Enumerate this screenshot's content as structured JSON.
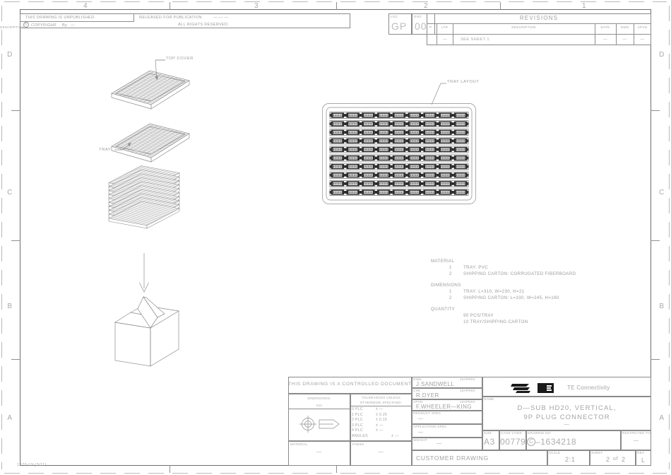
{
  "document": {
    "footer_code": "1470-19  (3/11)",
    "zone_numbers": [
      "4",
      "3",
      "2",
      "1"
    ],
    "zone_letters": [
      "D",
      "C",
      "B",
      "A"
    ]
  },
  "header": {
    "unpublished": "THIS DRAWING IS UNPUBLISHED.",
    "copyright_symbol": "C",
    "copyright_label": "COPYRIGHT",
    "copyright_value": "—",
    "by_label": "By",
    "by_value": "—",
    "released": "RELEASED FOR PUBLICATION",
    "released_value": "—.—  —",
    "all_rights": "ALL RIGHTS RESERVED."
  },
  "locdist": {
    "loc_label": "LOC",
    "loc_value": "GP",
    "dist_label": "DIST",
    "dist_value": "00"
  },
  "revisions": {
    "title": "REVISIONS",
    "columns": [
      "P",
      "LTR",
      "DESCRIPTION",
      "DATE",
      "DWN",
      "APVD"
    ],
    "rows": [
      {
        "p": "",
        "ltr": "—",
        "description": "SEE SHEET 1",
        "date": "—",
        "dwn": "—",
        "apvd": "—"
      }
    ]
  },
  "views": {
    "top_cover_label": "TOP COVER",
    "tray_label": "TRAY",
    "tray_layout_label": "TRAY LAYOUT",
    "tray_layout": {
      "rows": 10,
      "columns": 9
    },
    "stack_count": 10
  },
  "notes": {
    "material": {
      "heading": "MATERIAL",
      "items": [
        {
          "num": "1",
          "text": "TRAY: PVC"
        },
        {
          "num": "2",
          "text": "SHIPPING CARTON: CORRUGATED FIBERBOARD"
        }
      ]
    },
    "dimensions": {
      "heading": "DIMENSIONS",
      "items": [
        {
          "num": "1",
          "text": "TRAY: L=310, W=230, H=21"
        },
        {
          "num": "2",
          "text": "SHIPPING CARTON: L=330, W=245, H=160"
        }
      ]
    },
    "quantity": {
      "heading": "QUANTITY",
      "items": [
        {
          "num": "",
          "text": "90 PCS/TRAY"
        },
        {
          "num": "",
          "text": "10 TRAY/SHIPPING CARTON"
        }
      ]
    }
  },
  "titleblock": {
    "controlled": "THIS DRAWING IS A CONTROLLED DOCUMENT.",
    "dimensions_label": "DIMENSIONS:",
    "dimensions_units": "mm",
    "tolerances_label_1": "TOLERANCES UNLESS",
    "tolerances_label_2": "OTHERWISE SPECIFIED:",
    "tolerances": [
      {
        "name": "0 PLC",
        "value": "± —"
      },
      {
        "name": "1 PLC",
        "value": "± 0.25"
      },
      {
        "name": "2 PLC",
        "value": "± 0.15"
      },
      {
        "name": "3 PLC",
        "value": "± —"
      },
      {
        "name": "4 PLC",
        "value": "± —"
      },
      {
        "name": "ANGLES",
        "value": "± —"
      }
    ],
    "material_label": "MATERIAL",
    "material_value": "—",
    "finish_label": "FINISH",
    "finish_value": "—",
    "dwn_label": "DWN",
    "dwn_value": "J.SANDWELL",
    "dwn_date": "10APR03",
    "chk_label": "CHK",
    "chk_value": "R.DYER",
    "chk_date": "10APR03",
    "apvd_label": "APVD",
    "apvd_value": "F.WHEELER—KING",
    "apvd_date": "10APR03",
    "product_spec_label": "PRODUCT SPEC",
    "product_spec_value": "—",
    "application_spec_label": "APPLICATION SPEC",
    "application_spec_value": "—",
    "weight_label": "WEIGHT",
    "weight_value": "—",
    "customer_drawing": "CUSTOMER DRAWING",
    "company_logo": "TE",
    "company_name": "TE Connectivity",
    "name_label": "NAME",
    "name_line1": "D—SUB HD20, VERTICAL,",
    "name_line2": "9P PLUG CONNECTOR",
    "name_line3": "—",
    "size_label": "SIZE",
    "size_value": "A3",
    "cage_label": "CAGE CODE",
    "cage_value": "00779",
    "drawing_no_label": "DRAWING NO",
    "drawing_no_prefix": "C",
    "drawing_no_value": "–1634218",
    "restricted_label": "RESTRICTED TO",
    "restricted_value": "—",
    "scale_label": "SCALE",
    "scale_value": "2:1",
    "sheet_label": "SHEET",
    "sheet_value": "2",
    "sheet_of": "of",
    "sheet_total": "2",
    "rev_label": "REV",
    "rev_value": "L"
  }
}
